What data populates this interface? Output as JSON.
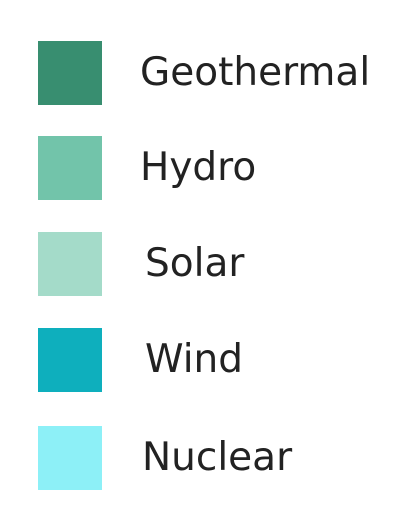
{
  "chart_data": {
    "type": "legend",
    "title": "",
    "legend": [
      {
        "label": "Geothermal",
        "color": "#388e70"
      },
      {
        "label": "Hydro",
        "color": "#72c4aa"
      },
      {
        "label": "Solar",
        "color": "#a4dbc9"
      },
      {
        "label": "Wind",
        "color": "#0eafbd"
      },
      {
        "label": "Nuclear",
        "color": "#8df0f7"
      }
    ]
  }
}
